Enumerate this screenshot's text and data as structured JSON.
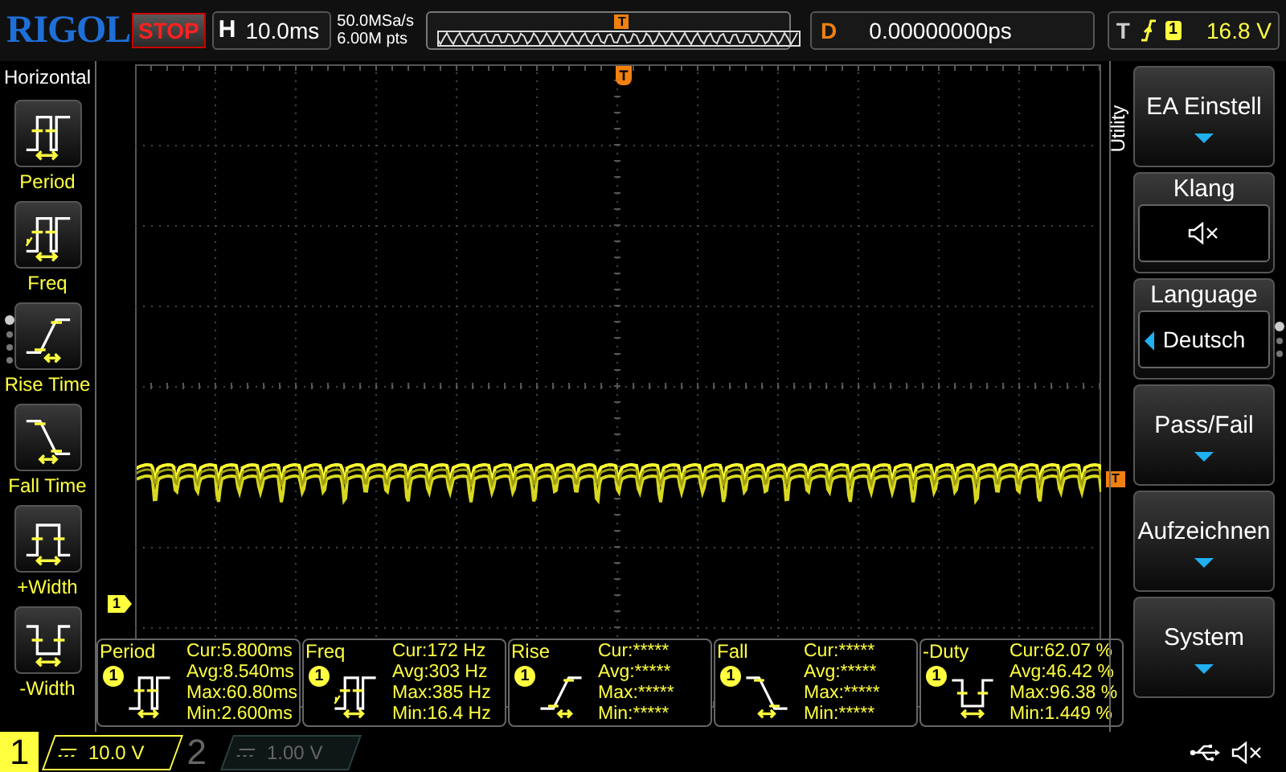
{
  "logo": "RIGOL",
  "run_state": "STOP",
  "timebase": {
    "label": "H",
    "value": "10.0ms"
  },
  "sampling": {
    "rate": "50.0MSa/s",
    "depth": "6.00M pts"
  },
  "overview_trigger_marker": "T",
  "delay": {
    "label": "D",
    "value": "0.00000000ps"
  },
  "trigger": {
    "label": "T",
    "channel": "1",
    "level": "16.8 V"
  },
  "grid_trigger_marker": "T",
  "left_menu": {
    "title": "Horizontal",
    "items": [
      {
        "kind": "period",
        "label": "Period"
      },
      {
        "kind": "freq",
        "label": "Freq"
      },
      {
        "kind": "rise",
        "label": "Rise Time"
      },
      {
        "kind": "fall",
        "label": "Fall Time"
      },
      {
        "kind": "pwidth",
        "label": "+Width"
      },
      {
        "kind": "nwidth",
        "label": "-Width"
      }
    ]
  },
  "channel_marker": "1",
  "trigger_level_marker": "T",
  "measurements": [
    {
      "kind": "period",
      "name": "Period",
      "channel": "1",
      "lines": [
        "Cur:5.800ms",
        "Avg:8.540ms",
        "Max:60.80ms",
        "Min:2.600ms"
      ]
    },
    {
      "kind": "freq",
      "name": "Freq",
      "channel": "1",
      "lines": [
        "Cur:172 Hz",
        "Avg:303 Hz",
        "Max:385 Hz",
        "Min:16.4 Hz"
      ]
    },
    {
      "kind": "rise",
      "name": "Rise",
      "channel": "1",
      "lines": [
        "Cur:*****",
        "Avg:*****",
        "Max:*****",
        "Min:*****"
      ]
    },
    {
      "kind": "fall",
      "name": "Fall",
      "channel": "1",
      "lines": [
        "Cur:*****",
        "Avg:*****",
        "Max:*****",
        "Min:*****"
      ]
    },
    {
      "kind": "nwidth",
      "name": "-Duty",
      "channel": "1",
      "lines": [
        "Cur:62.07 %",
        "Avg:46.42 %",
        "Max:96.38 %",
        "Min:1.449 %"
      ]
    }
  ],
  "right_menu": {
    "title": "Utility",
    "items": [
      {
        "kind": "submenu",
        "label": "EA Einstell"
      },
      {
        "kind": "sound",
        "label": "Klang"
      },
      {
        "kind": "option",
        "label": "Language",
        "value": "Deutsch"
      },
      {
        "kind": "submenu",
        "label": "Pass/Fail"
      },
      {
        "kind": "submenu",
        "label": "Aufzeichnen"
      },
      {
        "kind": "submenu",
        "label": "System"
      }
    ]
  },
  "channels": [
    {
      "number": "1",
      "scale": "10.0 V",
      "on": true
    },
    {
      "number": "2",
      "scale": "1.00 V",
      "on": false
    }
  ]
}
